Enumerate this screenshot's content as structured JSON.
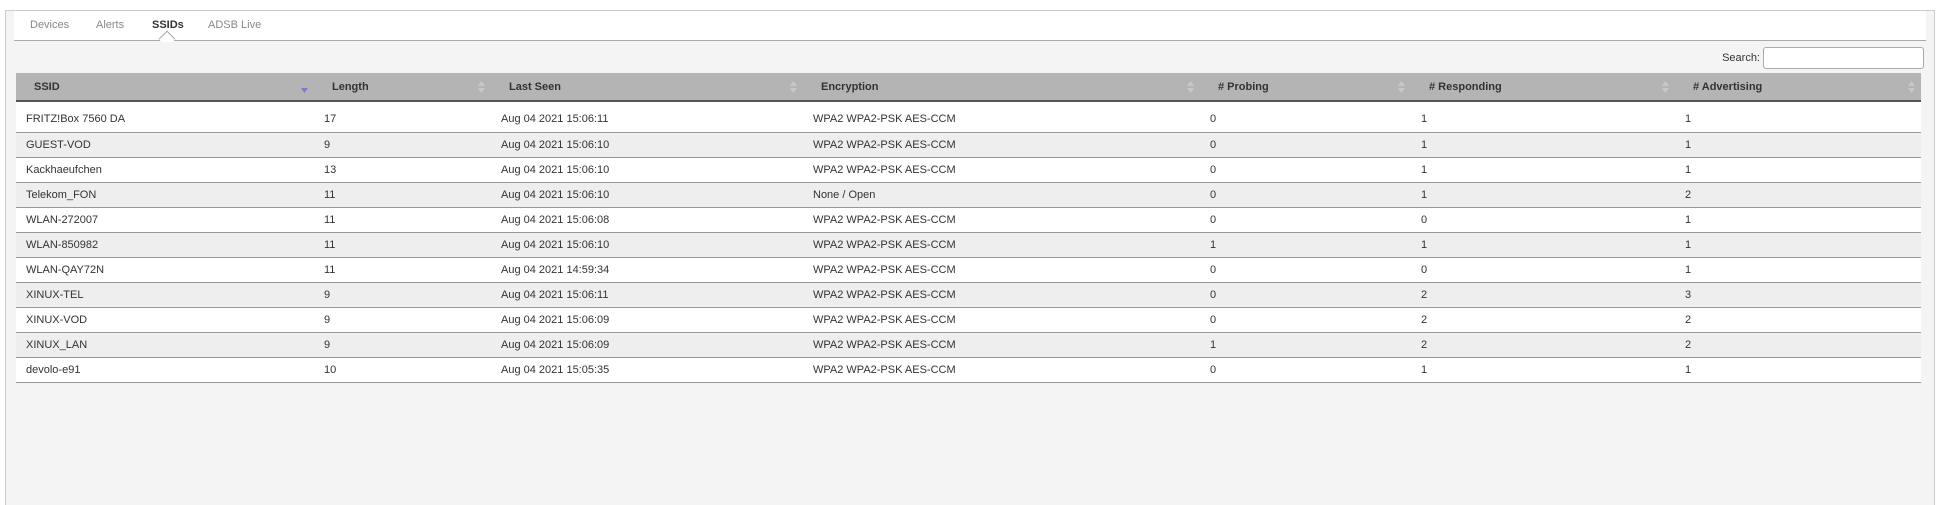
{
  "tabs": [
    {
      "label": "Devices",
      "active": false
    },
    {
      "label": "Alerts",
      "active": false
    },
    {
      "label": "SSIDs",
      "active": true
    },
    {
      "label": "ADSB Live",
      "active": false
    }
  ],
  "search": {
    "label": "Search:",
    "value": "",
    "placeholder": ""
  },
  "table": {
    "sorted_column": "SSID",
    "sort_direction": "descending",
    "columns": [
      "SSID",
      "Length",
      "Last Seen",
      "Encryption",
      "# Probing",
      "# Responding",
      "# Advertising"
    ],
    "rows": [
      [
        "FRITZ!Box 7560 DA",
        "17",
        "Aug 04 2021 15:06:11",
        "WPA2 WPA2-PSK AES-CCM",
        "0",
        "1",
        "1"
      ],
      [
        "GUEST-VOD",
        "9",
        "Aug 04 2021 15:06:10",
        "WPA2 WPA2-PSK AES-CCM",
        "0",
        "1",
        "1"
      ],
      [
        "Kackhaeufchen",
        "13",
        "Aug 04 2021 15:06:10",
        "WPA2 WPA2-PSK AES-CCM",
        "0",
        "1",
        "1"
      ],
      [
        "Telekom_FON",
        "11",
        "Aug 04 2021 15:06:10",
        "None / Open",
        "0",
        "1",
        "2"
      ],
      [
        "WLAN-272007",
        "11",
        "Aug 04 2021 15:06:08",
        "WPA2 WPA2-PSK AES-CCM",
        "0",
        "0",
        "1"
      ],
      [
        "WLAN-850982",
        "11",
        "Aug 04 2021 15:06:10",
        "WPA2 WPA2-PSK AES-CCM",
        "1",
        "1",
        "1"
      ],
      [
        "WLAN-QAY72N",
        "11",
        "Aug 04 2021 14:59:34",
        "WPA2 WPA2-PSK AES-CCM",
        "0",
        "0",
        "1"
      ],
      [
        "XINUX-TEL",
        "9",
        "Aug 04 2021 15:06:11",
        "WPA2 WPA2-PSK AES-CCM",
        "0",
        "2",
        "3"
      ],
      [
        "XINUX-VOD",
        "9",
        "Aug 04 2021 15:06:09",
        "WPA2 WPA2-PSK AES-CCM",
        "0",
        "2",
        "2"
      ],
      [
        "XINUX_LAN",
        "9",
        "Aug 04 2021 15:06:09",
        "WPA2 WPA2-PSK AES-CCM",
        "1",
        "2",
        "2"
      ],
      [
        "devolo-e91",
        "10",
        "Aug 04 2021 15:05:35",
        "WPA2 WPA2-PSK AES-CCM",
        "0",
        "1",
        "1"
      ]
    ]
  },
  "colors": {
    "header_bg": "#b4b4b4",
    "row_alt_bg": "#eeeeee",
    "sort_active": "#7b7bd6",
    "sort_inactive": "#c8c8c8"
  }
}
